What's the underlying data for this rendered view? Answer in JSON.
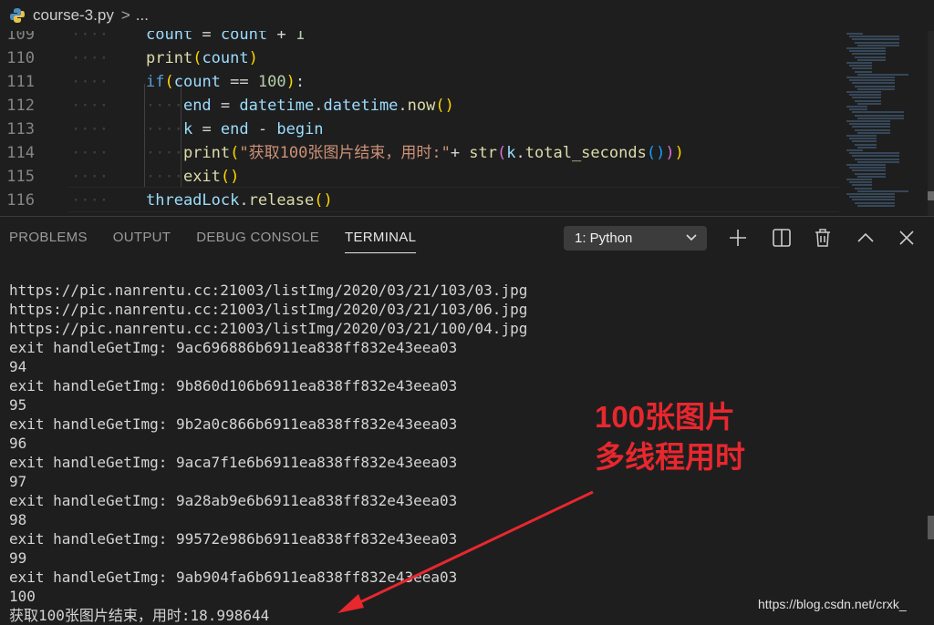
{
  "breadcrumb": {
    "file": "course-3.py",
    "separator": ">",
    "ellipsis": "..."
  },
  "editor": {
    "lines": [
      {
        "num": "109",
        "tokens": [
          [
            "var",
            "count"
          ],
          [
            "plain",
            " = "
          ],
          [
            "var",
            "count"
          ],
          [
            "plain",
            " + "
          ],
          [
            "num",
            "1"
          ]
        ]
      },
      {
        "num": "110",
        "tokens": [
          [
            "fn",
            "print"
          ],
          [
            "paren",
            "("
          ],
          [
            "var",
            "count"
          ],
          [
            "paren",
            ")"
          ]
        ]
      },
      {
        "num": "111",
        "tokens": [
          [
            "kw",
            "if"
          ],
          [
            "paren",
            "("
          ],
          [
            "var",
            "count"
          ],
          [
            "plain",
            " == "
          ],
          [
            "num",
            "100"
          ],
          [
            "paren",
            ")"
          ],
          [
            "plain",
            ":"
          ]
        ]
      },
      {
        "num": "112",
        "tokens": [
          [
            "plain",
            "    "
          ],
          [
            "var",
            "end"
          ],
          [
            "plain",
            " = "
          ],
          [
            "var",
            "datetime"
          ],
          [
            "plain",
            "."
          ],
          [
            "var",
            "datetime"
          ],
          [
            "plain",
            "."
          ],
          [
            "fn",
            "now"
          ],
          [
            "paren",
            "()"
          ]
        ]
      },
      {
        "num": "113",
        "tokens": [
          [
            "plain",
            "    "
          ],
          [
            "var",
            "k"
          ],
          [
            "plain",
            " = "
          ],
          [
            "var",
            "end"
          ],
          [
            "plain",
            " - "
          ],
          [
            "var",
            "begin"
          ]
        ]
      },
      {
        "num": "114",
        "tokens": [
          [
            "plain",
            "    "
          ],
          [
            "fn",
            "print"
          ],
          [
            "paren",
            "("
          ],
          [
            "str",
            "\"获取100张图片结束，用时:\""
          ],
          [
            "plain",
            "+ "
          ],
          [
            "fn",
            "str"
          ],
          [
            "paren2",
            "("
          ],
          [
            "var",
            "k"
          ],
          [
            "plain",
            "."
          ],
          [
            "fn",
            "total_seconds"
          ],
          [
            "paren3",
            "()"
          ],
          [
            "paren2",
            ")"
          ],
          [
            "paren",
            ")"
          ]
        ]
      },
      {
        "num": "115",
        "tokens": [
          [
            "plain",
            "    "
          ],
          [
            "fn",
            "exit"
          ],
          [
            "paren",
            "()"
          ]
        ]
      },
      {
        "num": "116",
        "tokens": [
          [
            "var",
            "threadLock"
          ],
          [
            "plain",
            "."
          ],
          [
            "fn",
            "release"
          ],
          [
            "paren",
            "()"
          ]
        ]
      }
    ]
  },
  "panel": {
    "tabs": [
      "PROBLEMS",
      "OUTPUT",
      "DEBUG CONSOLE",
      "TERMINAL"
    ],
    "active_tab": "TERMINAL",
    "terminal_select": "1: Python",
    "icons": [
      "plus-icon",
      "split-icon",
      "trash-icon",
      "chevron-up-icon",
      "close-icon"
    ]
  },
  "terminal": {
    "lines": [
      "https://pic.nanrentu.cc:21003/listImg/2020/03/21/103/03.jpg",
      "https://pic.nanrentu.cc:21003/listImg/2020/03/21/103/06.jpg",
      "https://pic.nanrentu.cc:21003/listImg/2020/03/21/100/04.jpg",
      "exit handleGetImg: 9ac696886b6911ea838ff832e43eea03",
      "94",
      "exit handleGetImg: 9b860d106b6911ea838ff832e43eea03",
      "95",
      "exit handleGetImg: 9b2a0c866b6911ea838ff832e43eea03",
      "96",
      "exit handleGetImg: 9aca7f1e6b6911ea838ff832e43eea03",
      "97",
      "exit handleGetImg: 9a28ab9e6b6911ea838ff832e43eea03",
      "98",
      "exit handleGetImg: 99572e986b6911ea838ff832e43eea03",
      "99",
      "exit handleGetImg: 9ab904fa6b6911ea838ff832e43eea03",
      "100",
      "获取100张图片结束，用时:18.998644"
    ]
  },
  "annotation": {
    "line1": "100张图片",
    "line2": "多线程用时",
    "color": "#e8272e"
  },
  "watermark": "https://blog.csdn.net/crxk_"
}
